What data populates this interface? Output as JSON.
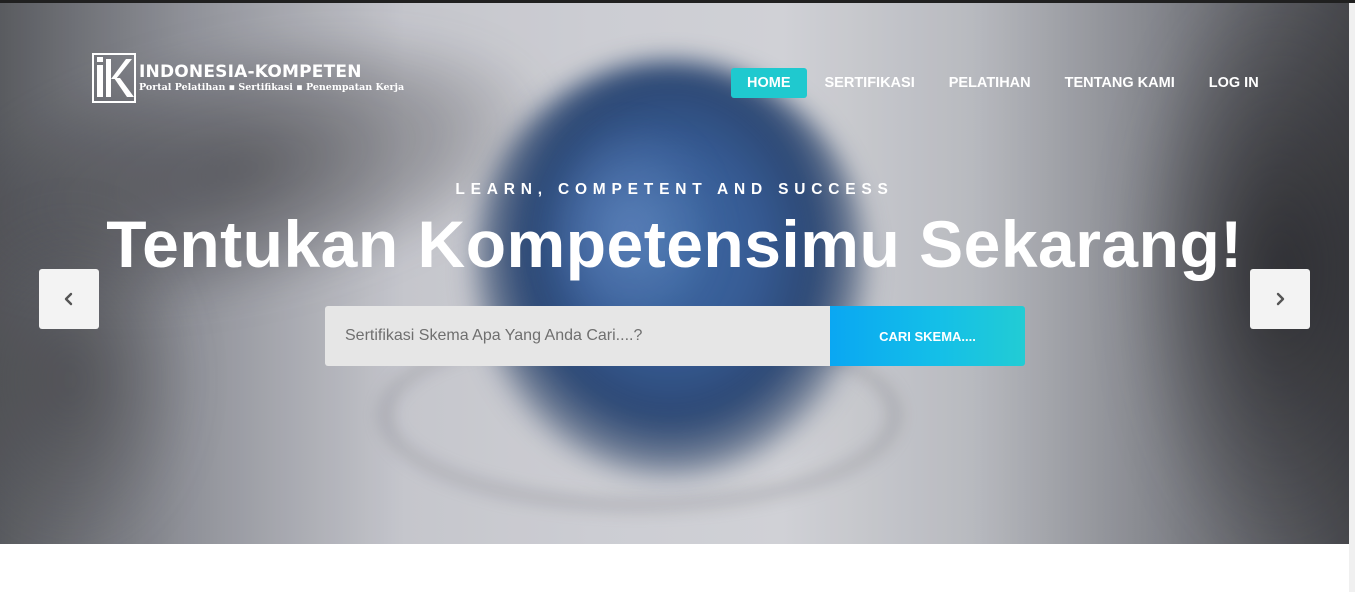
{
  "brand": {
    "title": "INDONESIA-KOMPETEN",
    "tagline": "Portal Pelatihan ▪ Sertifikasi ▪ Penempatan Kerja",
    "logo_icon": "ik-monogram-icon"
  },
  "nav": {
    "items": [
      {
        "label": "HOME",
        "active": true
      },
      {
        "label": "SERTIFIKASI",
        "active": false
      },
      {
        "label": "PELATIHAN",
        "active": false
      },
      {
        "label": "TENTANG KAMI",
        "active": false
      },
      {
        "label": "LOG IN",
        "active": false
      }
    ]
  },
  "hero": {
    "eyebrow": "LEARN, COMPETENT AND SUCCESS",
    "headline": "Tentukan Kompetensimu Sekarang!"
  },
  "search": {
    "value": "",
    "placeholder": "Sertifikasi Skema Apa Yang Anda Cari....?",
    "button_label": "CARI SKEMA...."
  },
  "carousel": {
    "prev_icon": "chevron-left-icon",
    "next_icon": "chevron-right-icon"
  },
  "colors": {
    "accent": "#1fc9cf",
    "search_button_start": "#0aa7f2",
    "search_button_end": "#22ccd4"
  }
}
